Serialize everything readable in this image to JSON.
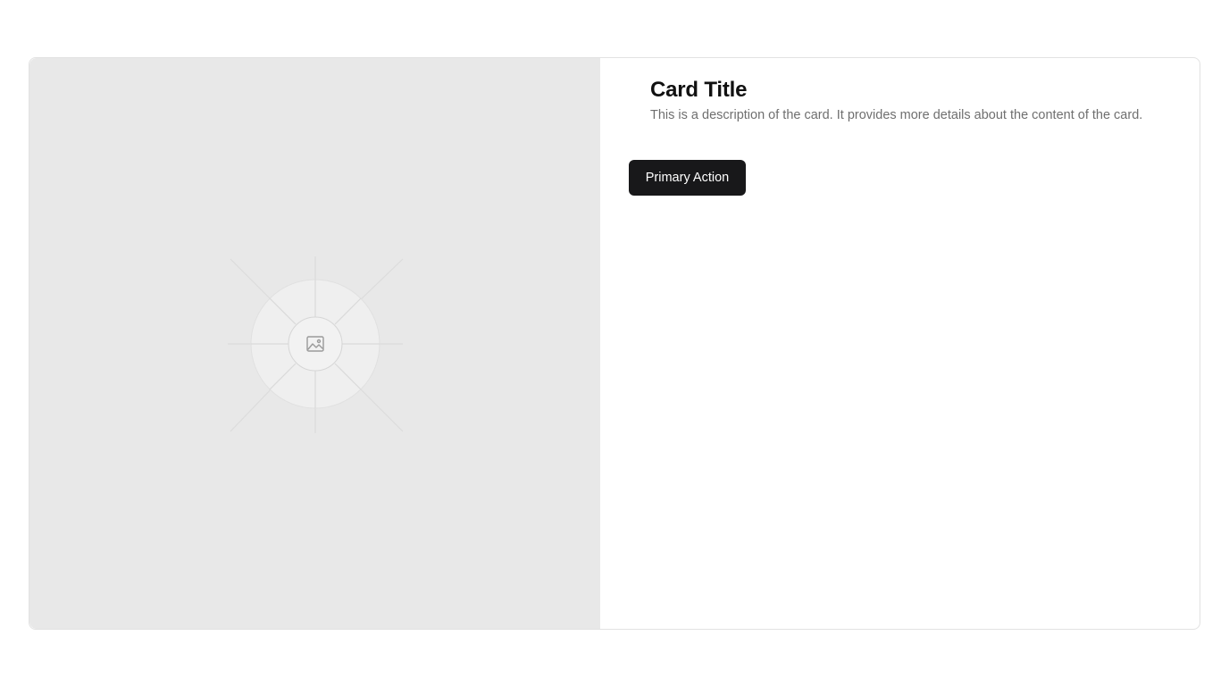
{
  "media": {
    "icon": "image-icon",
    "background": "#e8e8e8"
  },
  "card": {
    "title": "Card Title",
    "description": "This is a description of the card. It provides more details about the content of the card.",
    "primary_action_label": "Primary Action"
  },
  "colors": {
    "button_bg": "#18181a",
    "button_text": "#ffffff",
    "title": "#111111",
    "description": "#6f6f6f"
  }
}
